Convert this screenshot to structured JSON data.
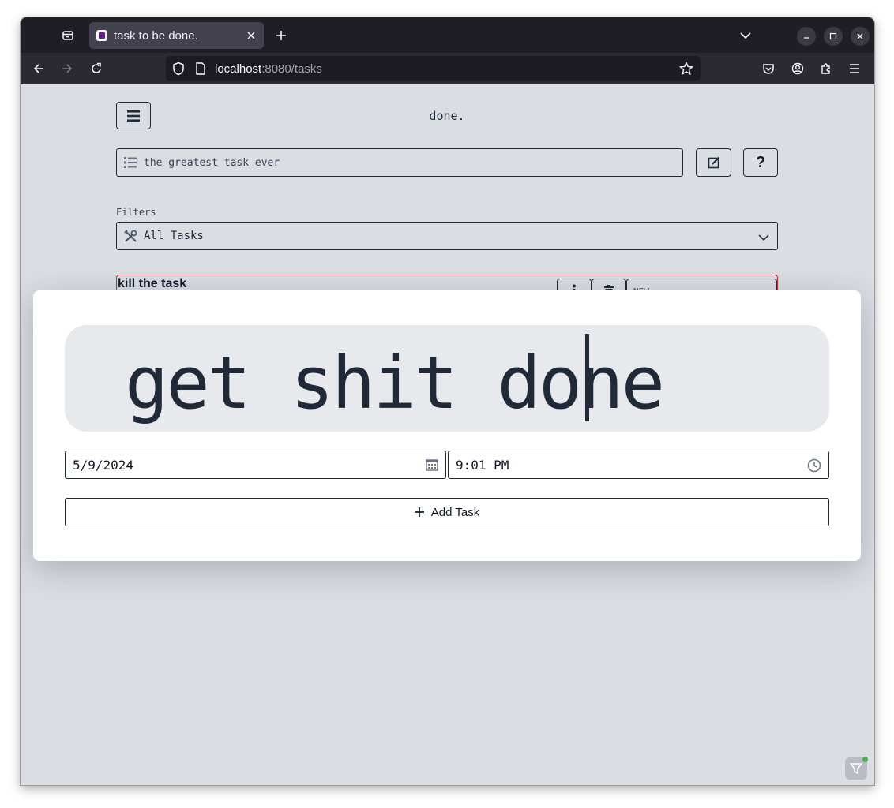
{
  "browser": {
    "tab_title": "task to be done.",
    "url_host": "localhost",
    "url_path": ":8080/tasks"
  },
  "app": {
    "title": "done.",
    "task_input_value": "the greatest task ever",
    "filters_label": "Filters",
    "filter_selected": "All Tasks",
    "help_label": "?"
  },
  "task_list": [
    {
      "name": "kill the task",
      "status": "NEW"
    }
  ],
  "modal": {
    "big_input_value": "get shit done",
    "date_value": "5/9/2024",
    "time_value": "9:01 PM",
    "add_button_label": "Add Task"
  },
  "colors": {
    "page_background": "#dadde2",
    "text": "#1f2937",
    "task_border_overdue": "#dc2626",
    "modal_input_bg": "#e7e9ed"
  }
}
